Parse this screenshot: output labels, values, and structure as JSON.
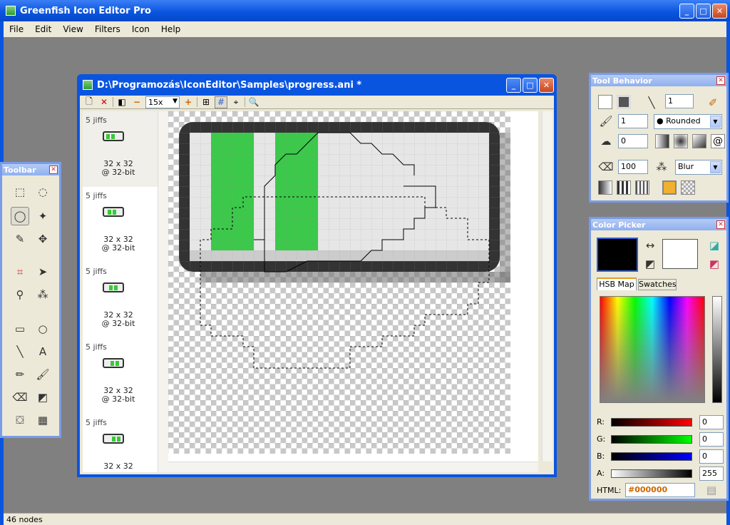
{
  "app": {
    "title": "Greenfish Icon Editor Pro",
    "status": "46 nodes"
  },
  "menu": [
    "File",
    "Edit",
    "View",
    "Filters",
    "Icon",
    "Help"
  ],
  "doc": {
    "title": "D:\\Programozás\\IconEditor\\Samples\\progress.ani *",
    "zoom": "15x"
  },
  "frames": [
    {
      "delay": "5 jiffs",
      "size": "32 x 32",
      "depth": "@ 32-bit"
    },
    {
      "delay": "5 jiffs",
      "size": "32 x 32",
      "depth": "@ 32-bit"
    },
    {
      "delay": "5 jiffs",
      "size": "32 x 32",
      "depth": "@ 32-bit"
    },
    {
      "delay": "5 jiffs",
      "size": "32 x 32",
      "depth": "@ 32-bit"
    },
    {
      "delay": "5 jiffs",
      "size": "32 x 32",
      "depth": ""
    }
  ],
  "toolbar": {
    "title": "Toolbar"
  },
  "toolbehavior": {
    "title": "Tool Behavior",
    "line_width": "1",
    "brush_size": "1",
    "shape": "Rounded",
    "value2": "0",
    "opacity": "100",
    "effect": "Blur"
  },
  "colorpicker": {
    "title": "Color Picker",
    "tab_hsb": "HSB Map",
    "tab_swatches": "Swatches",
    "r": "0",
    "g": "0",
    "b": "0",
    "a": "255",
    "html": "#000000",
    "r_label": "R:",
    "g_label": "G:",
    "b_label": "B:",
    "a_label": "A:",
    "html_label": "HTML:"
  }
}
